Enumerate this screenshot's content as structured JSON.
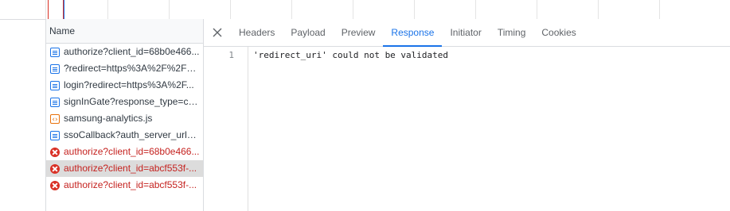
{
  "requests": {
    "header": "Name",
    "items": [
      {
        "name": "authorize?client_id=68b0e466...",
        "type": "doc",
        "status": "ok"
      },
      {
        "name": "?redirect=https%3A%2F%2Fap...",
        "type": "doc",
        "status": "ok"
      },
      {
        "name": "login?redirect=https%3A%2F...",
        "type": "doc",
        "status": "ok"
      },
      {
        "name": "signInGate?response_type=co...",
        "type": "doc",
        "status": "ok"
      },
      {
        "name": "samsung-analytics.js",
        "type": "script",
        "status": "ok"
      },
      {
        "name": "ssoCallback?auth_server_url=e...",
        "type": "doc",
        "status": "ok"
      },
      {
        "name": "authorize?client_id=68b0e466...",
        "type": "error",
        "status": "failed"
      },
      {
        "name": "authorize?client_id=abcf553f-...",
        "type": "error",
        "status": "failed",
        "selected": true
      },
      {
        "name": "authorize?client_id=abcf553f-...",
        "type": "error",
        "status": "failed"
      }
    ]
  },
  "detail": {
    "tabs": [
      "Headers",
      "Payload",
      "Preview",
      "Response",
      "Initiator",
      "Timing",
      "Cookies"
    ],
    "active_tab": "Response",
    "response": {
      "line_number": "1",
      "line_text": "'redirect_uri' could not be validated"
    }
  },
  "colors": {
    "accent": "#1a73e8",
    "error": "#c5221f",
    "selected_row": "#dcdcdc"
  }
}
